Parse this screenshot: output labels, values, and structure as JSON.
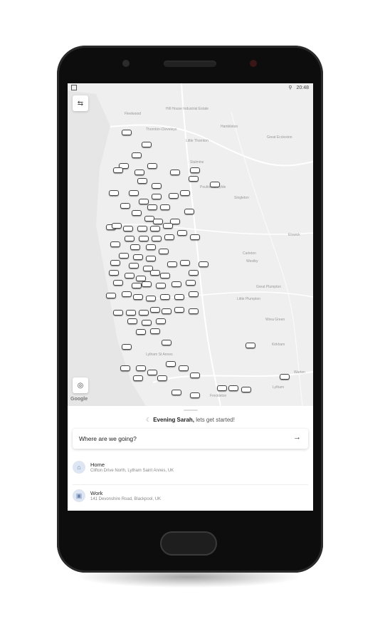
{
  "status_bar": {
    "time": "20:48"
  },
  "map": {
    "labels": [
      "Fleetwood",
      "Hambleton",
      "Thornton-Cleveleys",
      "Hill House Industrial Estate",
      "Little Thornton",
      "Stalmine",
      "Great Eccleston",
      "Poulton-le-Fylde",
      "Singleton",
      "Elswick",
      "Carleton",
      "Westby",
      "Great Plumpton",
      "Little Plumpton",
      "Wrea Green",
      "Kirkham",
      "Lytham St Annes",
      "Warton",
      "Lytham",
      "Freckleton"
    ],
    "attribution": "Google"
  },
  "sheet": {
    "greeting_name": "Evening Sarah,",
    "greeting_rest": " lets get started!",
    "search_placeholder": "Where are we going?",
    "places": [
      {
        "title": "Home",
        "subtitle": "Clifton Drive North, Lytham Saint Annes, UK",
        "icon": "home-icon"
      },
      {
        "title": "Work",
        "subtitle": "141 Devonshire Road, Blackpool, UK",
        "icon": "briefcase-icon"
      }
    ]
  }
}
